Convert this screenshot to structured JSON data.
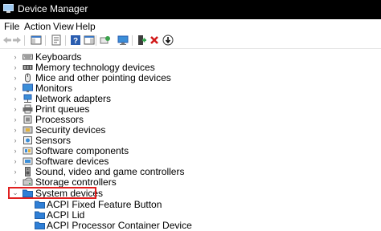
{
  "window": {
    "title": "Device Manager"
  },
  "menu": {
    "items": [
      "File",
      "Action",
      "View",
      "Help"
    ]
  },
  "toolbar": {
    "buttons": [
      "back-icon",
      "forward-icon",
      "show-hide-console-tree-icon",
      "properties-icon",
      "help-icon",
      "scan-hardware-icon",
      "display-monitor-icon",
      "add-driver-icon",
      "uninstall-device-icon",
      "update-driver-icon"
    ]
  },
  "tree": {
    "categories": [
      {
        "label": "Keyboards",
        "icon": "keyboard-icon"
      },
      {
        "label": "Memory technology devices",
        "icon": "memory-icon"
      },
      {
        "label": "Mice and other pointing devices",
        "icon": "mouse-icon"
      },
      {
        "label": "Monitors",
        "icon": "monitor-icon"
      },
      {
        "label": "Network adapters",
        "icon": "network-adapter-icon"
      },
      {
        "label": "Print queues",
        "icon": "printer-icon"
      },
      {
        "label": "Processors",
        "icon": "processor-icon"
      },
      {
        "label": "Security devices",
        "icon": "security-device-icon"
      },
      {
        "label": "Sensors",
        "icon": "sensor-icon"
      },
      {
        "label": "Software components",
        "icon": "software-component-icon"
      },
      {
        "label": "Software devices",
        "icon": "software-device-icon"
      },
      {
        "label": "Sound, video and game controllers",
        "icon": "speaker-icon"
      },
      {
        "label": "Storage controllers",
        "icon": "storage-controller-icon"
      },
      {
        "label": "System devices",
        "icon": "system-devices-folder-icon",
        "expanded": true,
        "highlighted": true
      }
    ],
    "system_devices_children": [
      {
        "label": "ACPI Fixed Feature Button",
        "icon": "device-icon"
      },
      {
        "label": "ACPI Lid",
        "icon": "device-icon"
      },
      {
        "label": "ACPI Processor Container Device",
        "icon": "device-icon"
      }
    ]
  },
  "colors": {
    "titlebar": "#000000",
    "highlight_border": "#e02020",
    "folder_blue": "#2f7fd6"
  }
}
